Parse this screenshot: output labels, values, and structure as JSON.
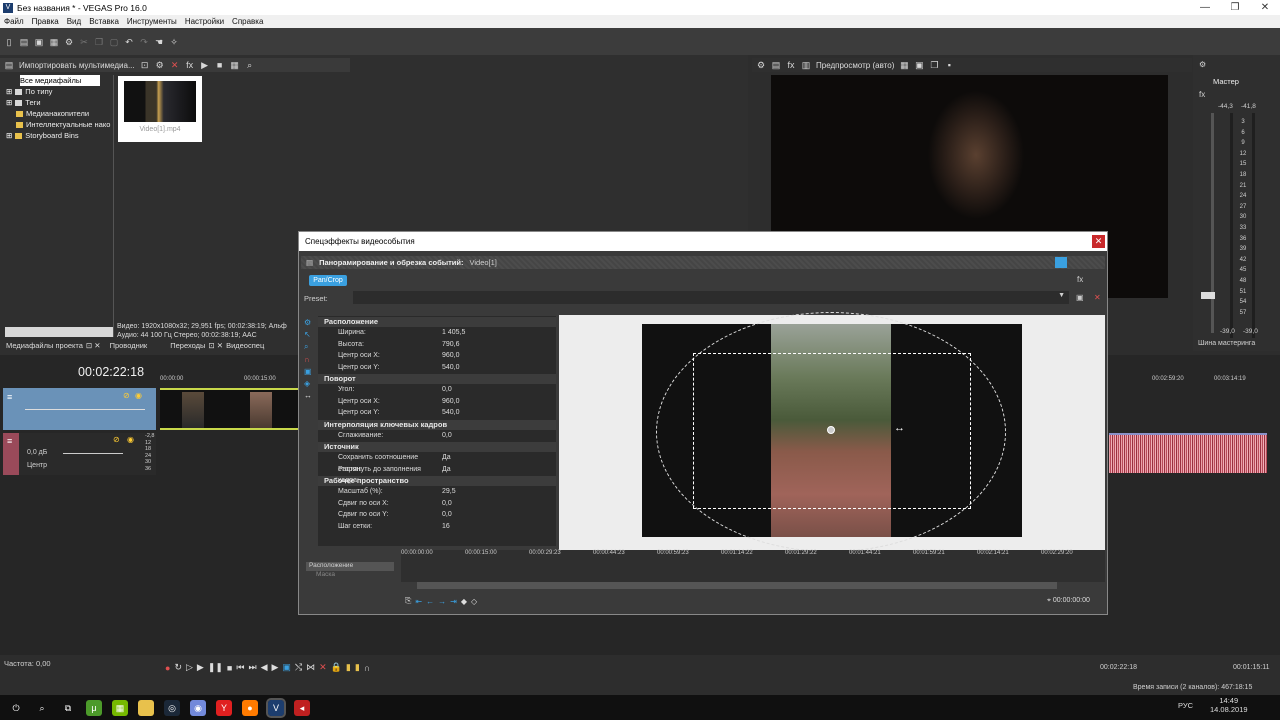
{
  "window": {
    "title": "Без названия * - VEGAS Pro 16.0",
    "icon": "V"
  },
  "menu": [
    "Файл",
    "Правка",
    "Вид",
    "Вставка",
    "Инструменты",
    "Настройки",
    "Справка"
  ],
  "media_panel": {
    "import_label": "Импортировать мультимедиа...",
    "tree": [
      "Все медиафайлы",
      "По типу",
      "Теги",
      "Медианакопители",
      "Интеллектуальные нако",
      "Storyboard Bins"
    ],
    "thumb_name": "Video[1].mp4",
    "info_video": "Видео: 1920x1080x32; 29,951 fps; 00:02:38:19; Альф",
    "info_audio": "Аудио: 44 100 Гц Стерео; 00:02:38:19; AAC",
    "tabs": [
      "Медиафайлы проекта",
      "Проводник",
      "Переходы",
      "Видеоспец"
    ]
  },
  "preview": {
    "label": "Предпросмотр (авто)"
  },
  "master": {
    "title": "Мастер",
    "left_peak": "-44,3",
    "right_peak": "-41,8",
    "scale": [
      "3",
      "6",
      "9",
      "12",
      "15",
      "18",
      "21",
      "24",
      "27",
      "30",
      "33",
      "36",
      "39",
      "42",
      "45",
      "48",
      "51",
      "54",
      "57"
    ],
    "bottom_left": "-39,0",
    "bottom_right": "-39,0",
    "footer": "Шина мастеринга"
  },
  "timeline": {
    "timecode": "00:02:22:18",
    "audio_db": "0,0 дБ",
    "audio_pan": "Центр",
    "audio_scale": [
      "-2,8",
      "12",
      "18",
      "24",
      "30",
      "36"
    ],
    "ruler": [
      "00:00:00",
      "00:00:15:00",
      "00:02:59:20",
      "00:03:14:19"
    ],
    "rate": "Частота: 0,00",
    "end_time": "00:02:22:18",
    "end_time2": "00:01:15:11",
    "record_time": "Время записи (2 каналов): 467:18:15"
  },
  "fx_dialog": {
    "title": "Спецэффекты видеособытия",
    "plugin": "Панорамирование и обрезка событий:",
    "event": "Video[1]",
    "chip": "Pan/Crop",
    "preset": "Preset:",
    "sections": [
      {
        "name": "Расположение",
        "rows": [
          [
            "Ширина:",
            "1 405,5"
          ],
          [
            "Высота:",
            "790,6"
          ],
          [
            "Центр оси X:",
            "960,0"
          ],
          [
            "Центр оси Y:",
            "540,0"
          ]
        ]
      },
      {
        "name": "Поворот",
        "rows": [
          [
            "Угол:",
            "0,0"
          ],
          [
            "Центр оси X:",
            "960,0"
          ],
          [
            "Центр оси Y:",
            "540,0"
          ]
        ]
      },
      {
        "name": "Интерполяция ключевых кадров",
        "rows": [
          [
            "Сглаживание:",
            "0,0"
          ]
        ]
      },
      {
        "name": "Источник",
        "rows": [
          [
            "Сохранить соотношение сторон:",
            "Да"
          ],
          [
            "Растянуть до заполнения кадра:",
            "Да"
          ]
        ]
      },
      {
        "name": "Рабочее пространство",
        "rows": [
          [
            "Масштаб (%):",
            "29,5"
          ],
          [
            "Сдвиг по оси X:",
            "0,0"
          ],
          [
            "Сдвиг по оси Y:",
            "0,0"
          ],
          [
            "Шаг сетки:",
            "16"
          ]
        ]
      }
    ],
    "kf_tracks": [
      "Расположение",
      "Маска"
    ],
    "kf_ruler": [
      "00:00:00:00",
      "00:00:15:00",
      "00:00:29:23",
      "00:00:44:23",
      "00:00:59:23",
      "00:01:14:22",
      "00:01:29:22",
      "00:01:44:21",
      "00:01:59:21",
      "00:02:14:21",
      "00:02:29:20"
    ],
    "kf_time": "00:00:00:00"
  },
  "taskbar": {
    "lang": "РУС",
    "time": "14:49",
    "date": "14.08.2019"
  },
  "colors": {
    "accent": "#3aa0e0",
    "clip_green": "#c8d84a",
    "audio_red": "#b94a5a"
  }
}
